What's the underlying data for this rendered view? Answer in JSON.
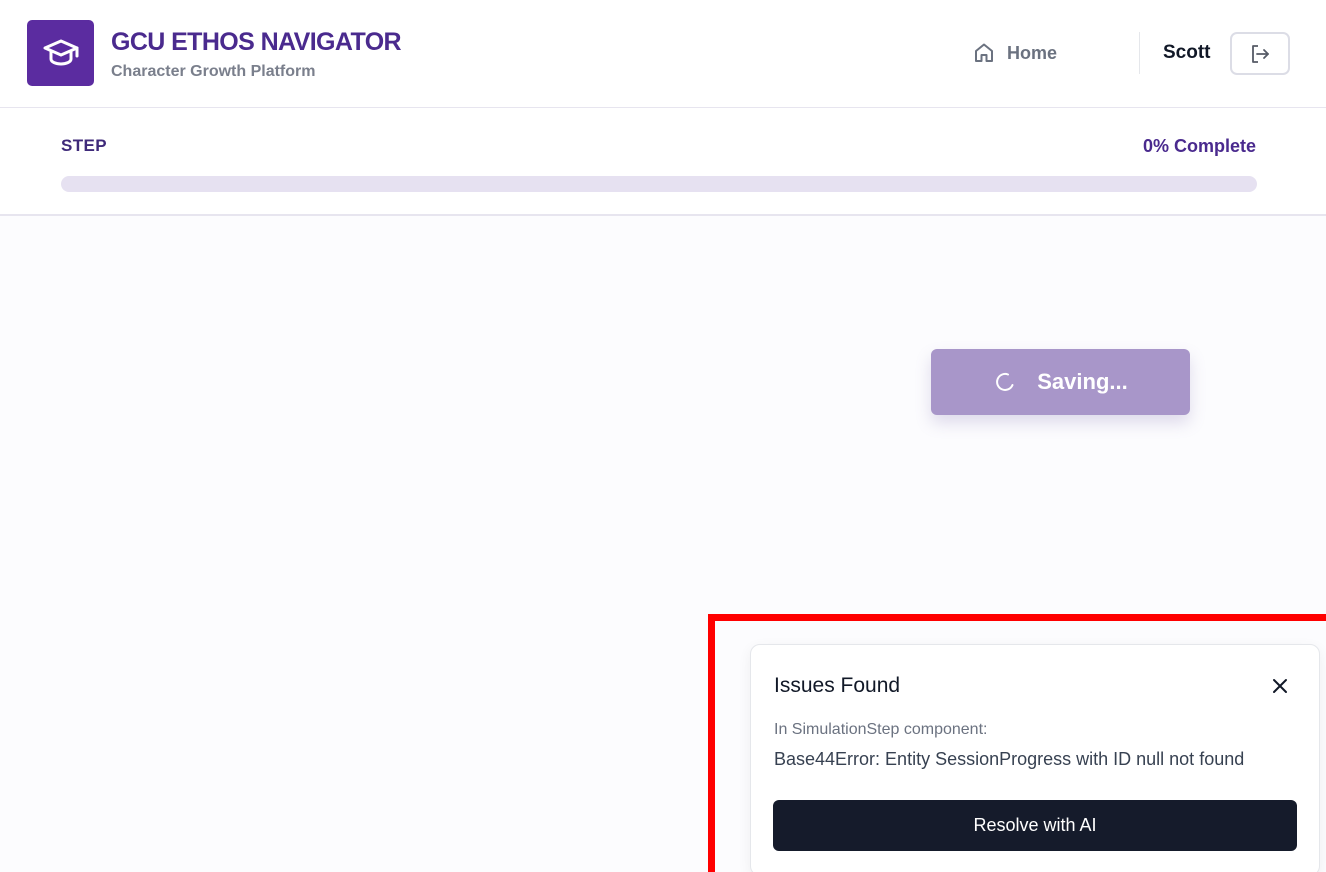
{
  "header": {
    "brand_title": "GCU ETHOS NAVIGATOR",
    "brand_subtitle": "Character Growth Platform",
    "logo_icon": "graduation-cap-icon",
    "home_label": "Home",
    "home_icon": "home-icon",
    "user_name": "Scott",
    "logout_icon": "logout-icon"
  },
  "progress": {
    "step_label": "STEP",
    "completion_text": "0% Complete",
    "percent": 0
  },
  "main": {
    "saving_label": "Saving...",
    "saving_icon": "spinner-icon"
  },
  "issues": {
    "title": "Issues Found",
    "context": "In SimulationStep component:",
    "message": "Base44Error: Entity SessionProgress with ID null not found",
    "resolve_label": "Resolve with AI",
    "close_icon": "close-icon"
  },
  "colors": {
    "brand": "#5b2ca0",
    "saving_button": "#a896c9",
    "resolve_button": "#151b2b",
    "highlight": "#ff0000"
  }
}
